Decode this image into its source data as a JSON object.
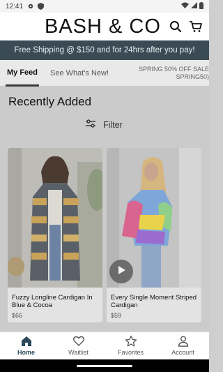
{
  "status_bar": {
    "time": "12:41"
  },
  "header": {
    "logo": "BASH & CO"
  },
  "promo_banner": {
    "text": "Free Shipping @ $150 and for 24hrs after you pay!"
  },
  "tabs": [
    {
      "label": "My Feed"
    },
    {
      "label": "See What's New!"
    }
  ],
  "tab_promo": {
    "line1": "SPRING 50% OFF SALE",
    "line2": "SPRING50)"
  },
  "section": {
    "title": "Recently Added",
    "filter_label": "Filter"
  },
  "products": [
    {
      "name": "Fuzzy Longline Cardigan In Blue & Cocoa",
      "price": "$66"
    },
    {
      "name": "Every Single Moment Striped Cardigan",
      "price": "$59"
    }
  ],
  "bottom_nav": [
    {
      "label": "Home"
    },
    {
      "label": "Waitlist"
    },
    {
      "label": "Favorites"
    },
    {
      "label": "Account"
    }
  ],
  "colors": {
    "promo_bg": "#3b4b55",
    "accent": "#2b4a5c"
  }
}
